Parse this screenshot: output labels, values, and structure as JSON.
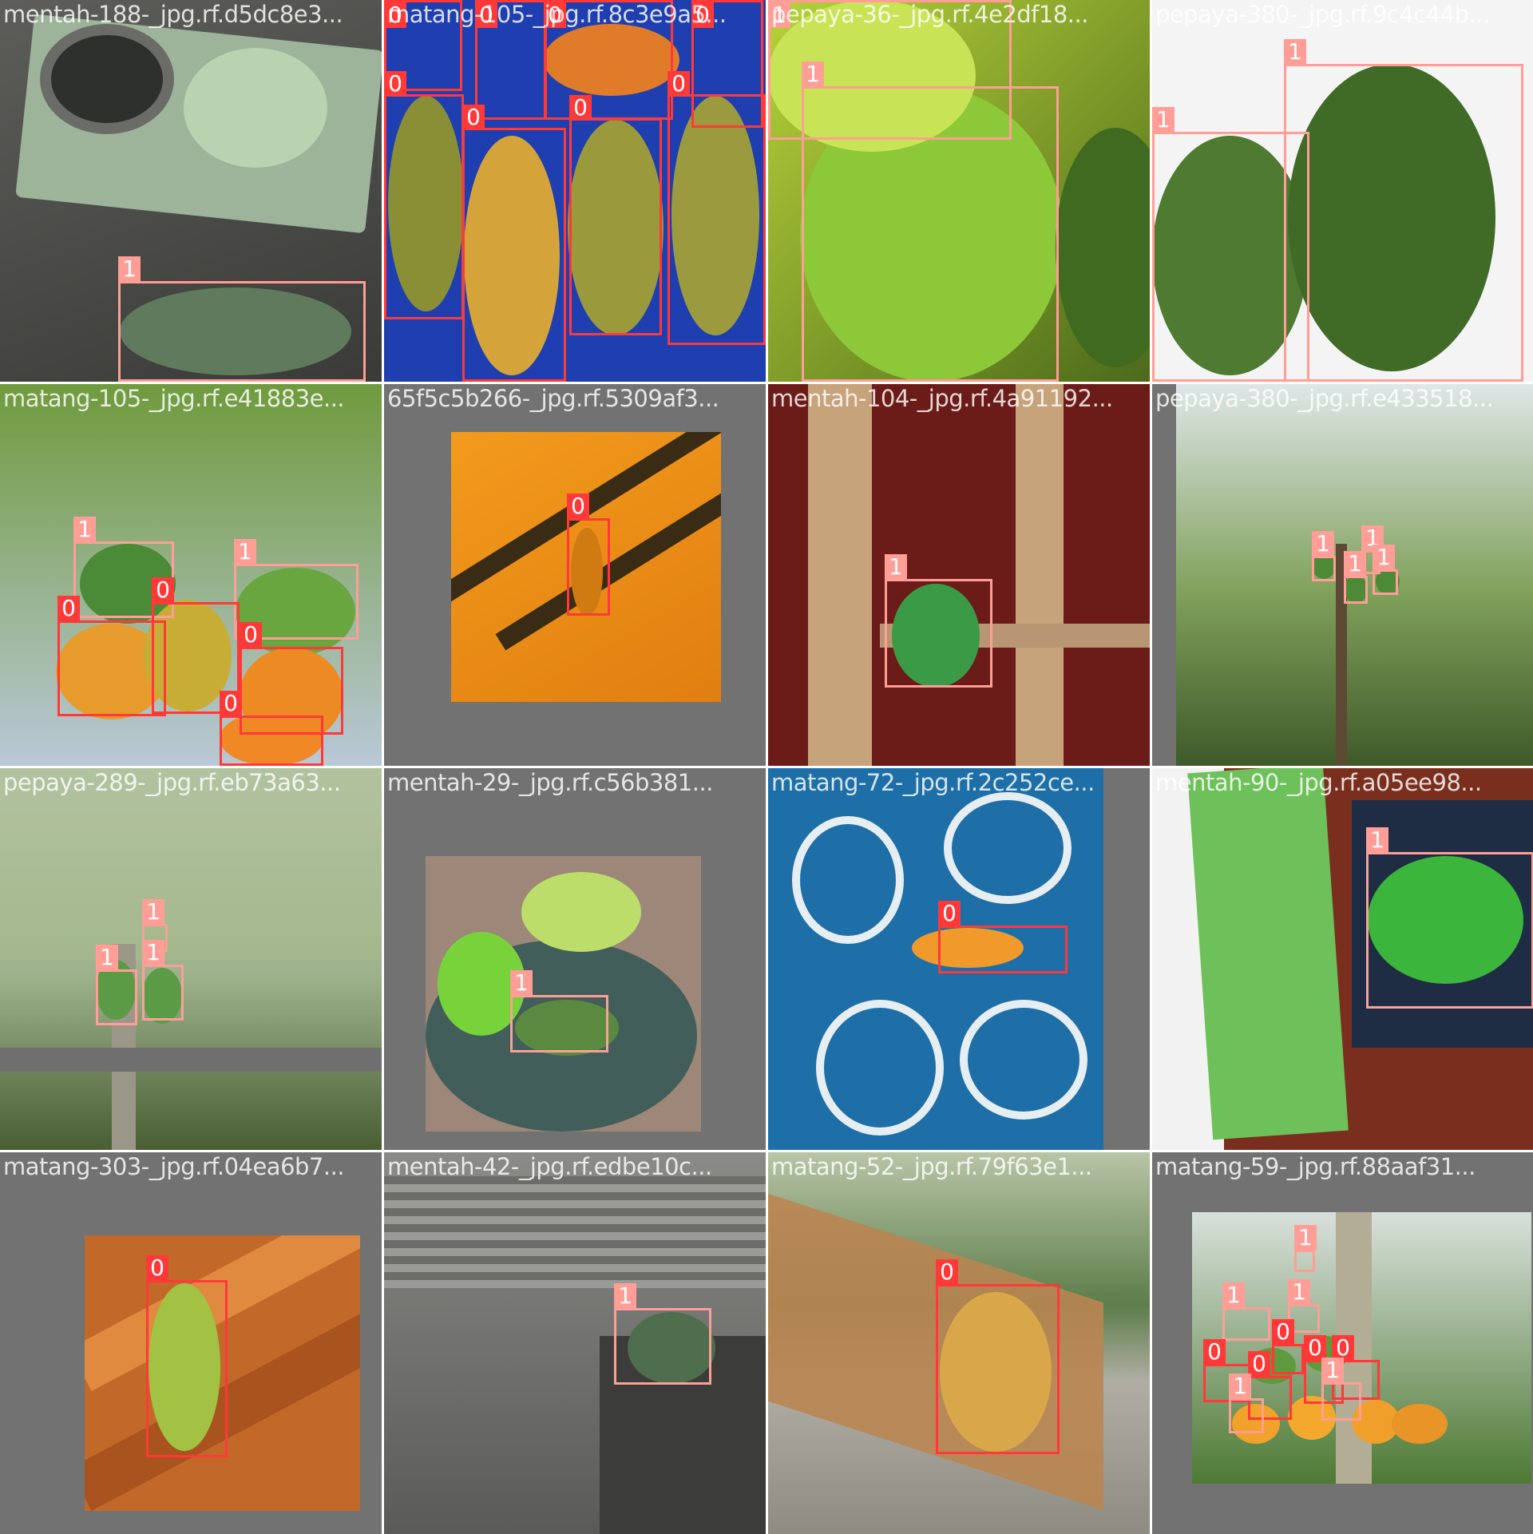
{
  "mosaic": {
    "tiles": [
      {
        "filename": "mentah-188-_jpg.rf.d5dc8e3...",
        "boxes": [
          {
            "cls": "1"
          }
        ]
      },
      {
        "filename": "matang-105-_jpg.rf.8c3e9a5...",
        "boxes": [
          {
            "cls": "0"
          },
          {
            "cls": "0"
          },
          {
            "cls": "0"
          },
          {
            "cls": "0"
          },
          {
            "cls": "0"
          },
          {
            "cls": "0"
          },
          {
            "cls": "0"
          },
          {
            "cls": "0"
          }
        ]
      },
      {
        "filename": "pepaya-36-_jpg.rf.4e2df18...",
        "boxes": [
          {
            "cls": "1"
          },
          {
            "cls": "1"
          }
        ]
      },
      {
        "filename": "pepaya-380-_jpg.rf.9c4c44b...",
        "boxes": [
          {
            "cls": "1"
          },
          {
            "cls": "1"
          }
        ]
      },
      {
        "filename": "matang-105-_jpg.rf.e41883e...",
        "boxes": [
          {
            "cls": "1"
          },
          {
            "cls": "1"
          },
          {
            "cls": "0"
          },
          {
            "cls": "0"
          },
          {
            "cls": "0"
          },
          {
            "cls": "0"
          }
        ]
      },
      {
        "filename": "65f5c5b266-_jpg.rf.5309af3...",
        "boxes": [
          {
            "cls": "0"
          }
        ]
      },
      {
        "filename": "mentah-104-_jpg.rf.4a91192...",
        "boxes": [
          {
            "cls": "1"
          }
        ]
      },
      {
        "filename": "pepaya-380-_jpg.rf.e433518...",
        "boxes": [
          {
            "cls": "1"
          },
          {
            "cls": "1"
          },
          {
            "cls": "1"
          },
          {
            "cls": "1"
          }
        ]
      },
      {
        "filename": "pepaya-289-_jpg.rf.eb73a63...",
        "boxes": [
          {
            "cls": "1"
          },
          {
            "cls": "1"
          },
          {
            "cls": "1"
          }
        ]
      },
      {
        "filename": "mentah-29-_jpg.rf.c56b381...",
        "boxes": [
          {
            "cls": "1"
          }
        ]
      },
      {
        "filename": "matang-72-_jpg.rf.2c252ce...",
        "boxes": [
          {
            "cls": "0"
          }
        ]
      },
      {
        "filename": "mentah-90-_jpg.rf.a05ee98...",
        "boxes": [
          {
            "cls": "1"
          }
        ]
      },
      {
        "filename": "matang-303-_jpg.rf.04ea6b7...",
        "boxes": [
          {
            "cls": "0"
          }
        ]
      },
      {
        "filename": "mentah-42-_jpg.rf.edbe10c...",
        "boxes": [
          {
            "cls": "1"
          }
        ]
      },
      {
        "filename": "matang-52-_jpg.rf.79f63e1...",
        "boxes": [
          {
            "cls": "0"
          }
        ]
      },
      {
        "filename": "matang-59-_jpg.rf.88aaf31...",
        "boxes": [
          {
            "cls": "1"
          },
          {
            "cls": "1"
          },
          {
            "cls": "1"
          },
          {
            "cls": "0"
          },
          {
            "cls": "0"
          },
          {
            "cls": "0"
          },
          {
            "cls": "0"
          },
          {
            "cls": "0"
          },
          {
            "cls": "1"
          },
          {
            "cls": "1"
          }
        ]
      }
    ]
  },
  "colors": {
    "class_0": "#ff3838",
    "class_1": "#ff9d97",
    "padding_gray": "#727272",
    "background": "#ffffff"
  }
}
